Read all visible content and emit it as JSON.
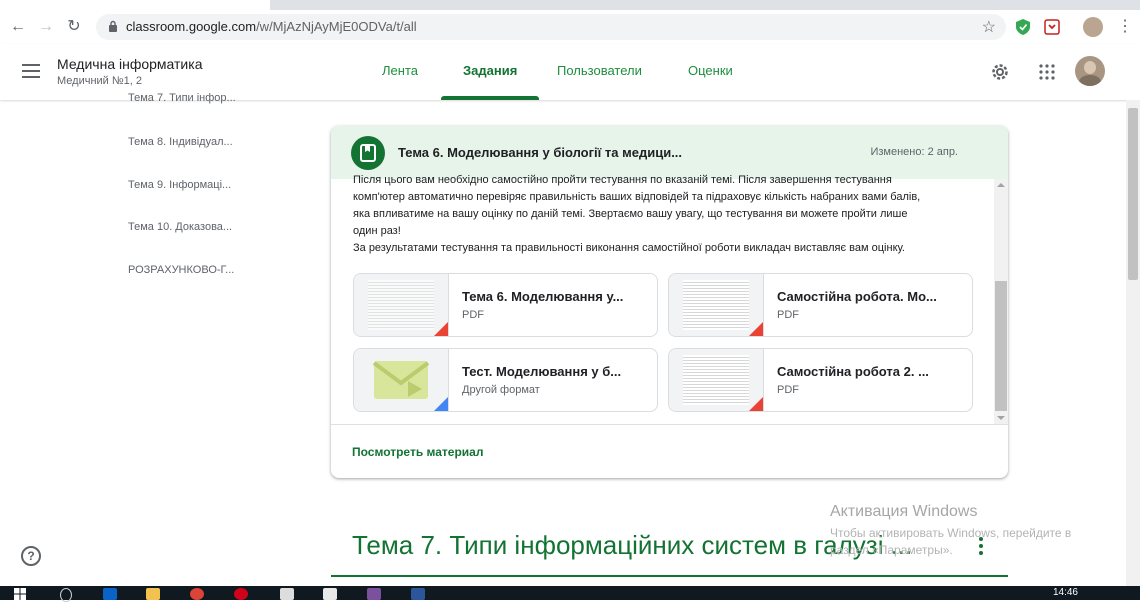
{
  "browser": {
    "url_host": "classroom.google.com",
    "url_path": "/w/MjAzNjAyMjE0ODVa/t/all"
  },
  "header": {
    "class_title": "Медична інформатика",
    "class_subtitle": "Медичний №1, 2",
    "tabs": [
      {
        "label": "Лента",
        "active": false
      },
      {
        "label": "Задания",
        "active": true
      },
      {
        "label": "Пользователи",
        "active": false
      },
      {
        "label": "Оценки",
        "active": false
      }
    ]
  },
  "sidebar": {
    "topics": [
      "Тема 7. Типи інфор...",
      "Тема 8. Індивідуал...",
      "Тема 9. Інформаці...",
      "Тема 10. Доказова...",
      "РОЗРАХУНКОВО-Г..."
    ]
  },
  "card": {
    "title": "Тема 6. Моделювання у біології та медици...",
    "modified": "Изменено: 2 апр.",
    "desc_line0": "Після цього вам необхідно самостійно пройти тестування по вказаній темі. Після завершення тестування",
    "desc_line1": "комп'ютер автоматично перевіряє правильність ваших відповідей та підраховує кількість набраних вами балів,",
    "desc_line2": "яка впливатиме на вашу оцінку по даній темі. Звертаємо вашу увагу, що тестування ви можете пройти лише",
    "desc_line3": "один раз!",
    "desc_line4": "За результатами тестування та правильності виконання самостійної роботи викладач виставляє вам оцінку.",
    "attachments": [
      {
        "name": "Тема 6. Моделювання у...",
        "type": "PDF"
      },
      {
        "name": "Самостійна робота. Мо...",
        "type": "PDF"
      },
      {
        "name": "Тест. Моделювання у б...",
        "type": "Другой формат"
      },
      {
        "name": "Самостійна робота 2. ...",
        "type": "PDF"
      }
    ],
    "view_link": "Посмотреть материал"
  },
  "next_topic": {
    "title": "Тема 7. Типи інформаційних систем в галузі ..."
  },
  "watermark": {
    "line1": "Активация Windows",
    "line2": "Чтобы активировать Windows, перейдите в",
    "line3": "раздел «Параметры»."
  },
  "taskbar": {
    "time": "14:46"
  },
  "colors": {
    "accent": "#137333",
    "card_header_bg": "#e6f4ea"
  }
}
